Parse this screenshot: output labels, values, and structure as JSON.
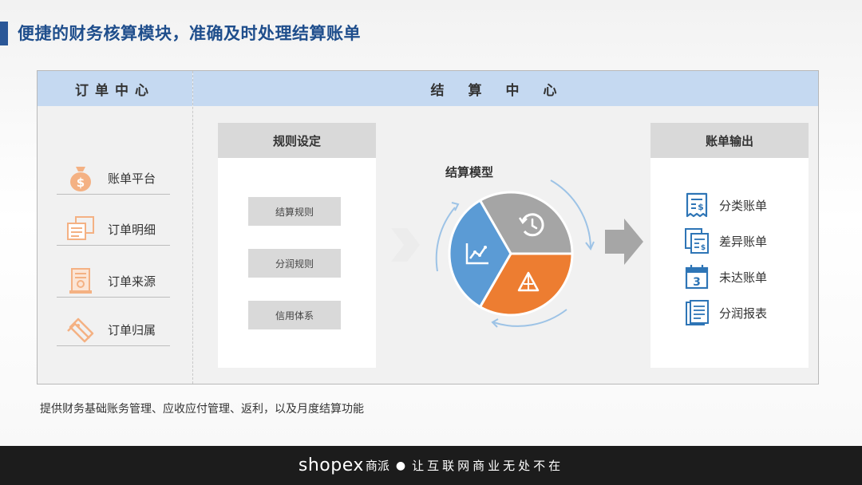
{
  "page": {
    "title": "便捷的财务核算模块，准确及时处理结算账单",
    "caption": "提供财务基础账务管理、应收应付管理、返利，以及月度结算功能"
  },
  "order_center": {
    "header": "订单中心",
    "items": [
      {
        "label": "账单平台",
        "icon": "money-bag-icon"
      },
      {
        "label": "订单明细",
        "icon": "documents-icon"
      },
      {
        "label": "订单来源",
        "icon": "scroll-icon"
      },
      {
        "label": "订单归属",
        "icon": "tag-icon"
      }
    ]
  },
  "settlement_center": {
    "header": "结算中心",
    "rules": {
      "header": "规则设定",
      "items": [
        "结算规则",
        "分润规则",
        "信用体系"
      ]
    },
    "model": {
      "title": "结算模型"
    },
    "bills": {
      "header": "账单输出",
      "items": [
        {
          "label": "分类账单",
          "icon": "receipt-icon"
        },
        {
          "label": "差异账单",
          "icon": "papers-icon"
        },
        {
          "label": "未达账单",
          "icon": "calendar-icon"
        },
        {
          "label": "分润报表",
          "icon": "report-icon"
        }
      ]
    }
  },
  "colors": {
    "accent": "#1f4e8c",
    "header_band": "#c5d9f1",
    "pie_blue": "#5b9bd5",
    "pie_gray": "#a5a5a5",
    "pie_orange": "#ed7d31",
    "icon_orange": "#f4b183",
    "icon_blue": "#2e75b6"
  },
  "footer": {
    "brand": "shopex",
    "brand_cn": "商派",
    "slogan": "让互联网商业无处不在"
  }
}
